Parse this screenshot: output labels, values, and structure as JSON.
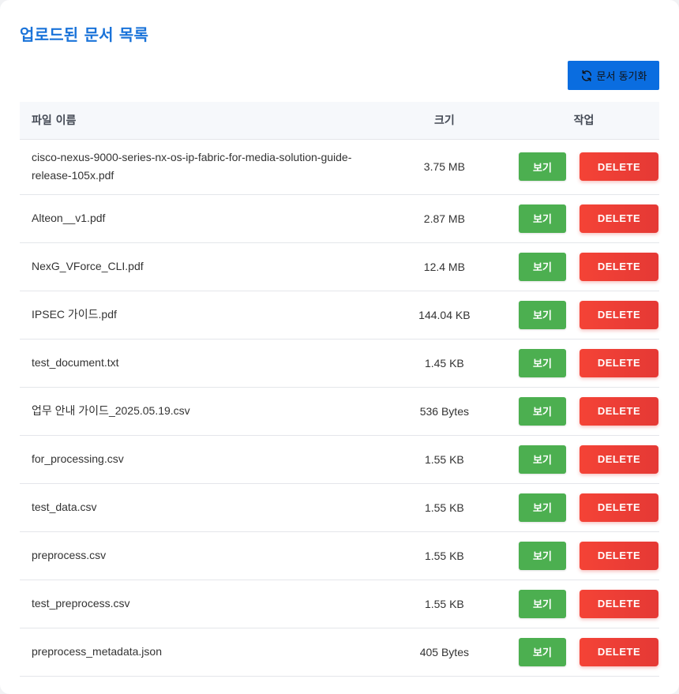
{
  "page": {
    "title": "업로드된 문서 목록",
    "sync_button_label": "문서 동기화",
    "sync_icon": "refresh-icon"
  },
  "table": {
    "headers": {
      "name": "파일 이름",
      "size": "크기",
      "actions": "작업"
    },
    "view_label": "보기",
    "delete_label": "DELETE",
    "rows": [
      {
        "name": "cisco-nexus-9000-series-nx-os-ip-fabric-for-media-solution-guide-release-105x.pdf",
        "size": "3.75 MB"
      },
      {
        "name": "Alteon__v1.pdf",
        "size": "2.87 MB"
      },
      {
        "name": "NexG_VForce_CLI.pdf",
        "size": "12.4 MB"
      },
      {
        "name": "IPSEC 가이드.pdf",
        "size": "144.04 KB"
      },
      {
        "name": "test_document.txt",
        "size": "1.45 KB"
      },
      {
        "name": "업무 안내 가이드_2025.05.19.csv",
        "size": "536 Bytes"
      },
      {
        "name": "for_processing.csv",
        "size": "1.55 KB"
      },
      {
        "name": "test_data.csv",
        "size": "1.55 KB"
      },
      {
        "name": "preprocess.csv",
        "size": "1.55 KB"
      },
      {
        "name": "test_preprocess.csv",
        "size": "1.55 KB"
      },
      {
        "name": "preprocess_metadata.json",
        "size": "405 Bytes"
      }
    ]
  },
  "colors": {
    "title": "#1a73d9",
    "sync_button": "#0a6de0",
    "view_button": "#4caf50",
    "delete_button": "#f44336",
    "header_bg": "#f6f8fb"
  }
}
